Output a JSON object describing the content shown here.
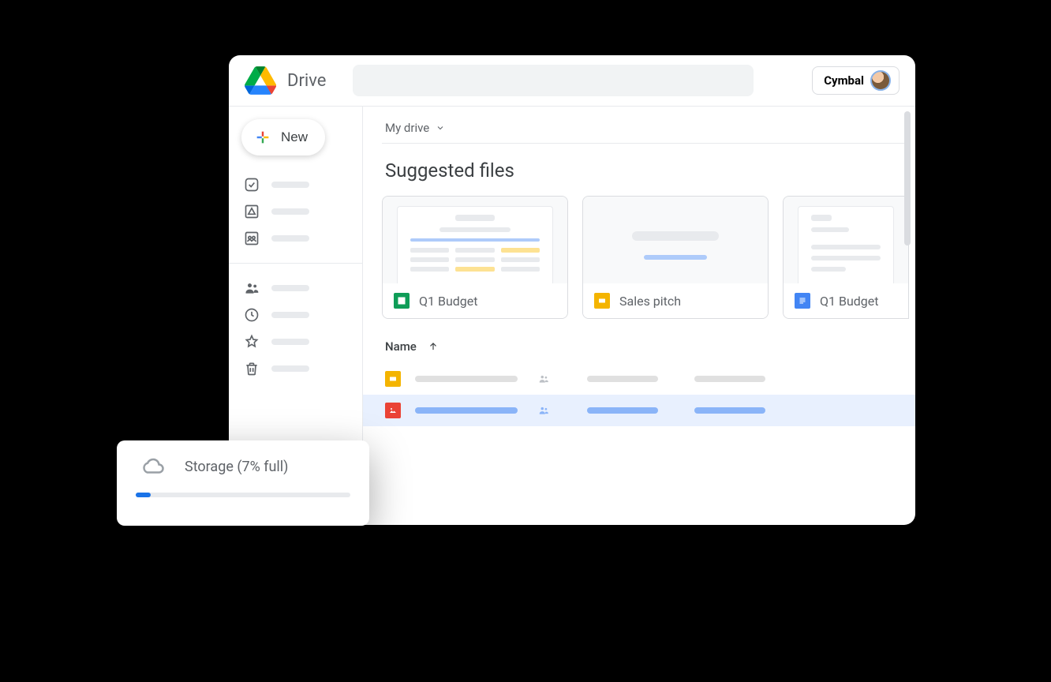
{
  "app": {
    "title": "Drive"
  },
  "org": {
    "name": "Cymbal"
  },
  "new_button": {
    "label": "New"
  },
  "breadcrumb": {
    "label": "My drive"
  },
  "section": {
    "suggested_title": "Suggested files"
  },
  "suggested": [
    {
      "label": "Q1 Budget",
      "type": "sheet"
    },
    {
      "label": "Sales pitch",
      "type": "slide"
    },
    {
      "label": "Q1 Budget",
      "type": "doc"
    }
  ],
  "table": {
    "name_header": "Name",
    "sort": "asc"
  },
  "rows": [
    {
      "type": "slide",
      "selected": false
    },
    {
      "type": "image",
      "selected": true
    }
  ],
  "storage": {
    "label": "Storage (7% full)",
    "percent": 7
  },
  "colors": {
    "sheet": "#0f9d58",
    "slide": "#f4b400",
    "doc": "#4285f4",
    "image": "#ea4335",
    "blue": "#1a73e8"
  }
}
